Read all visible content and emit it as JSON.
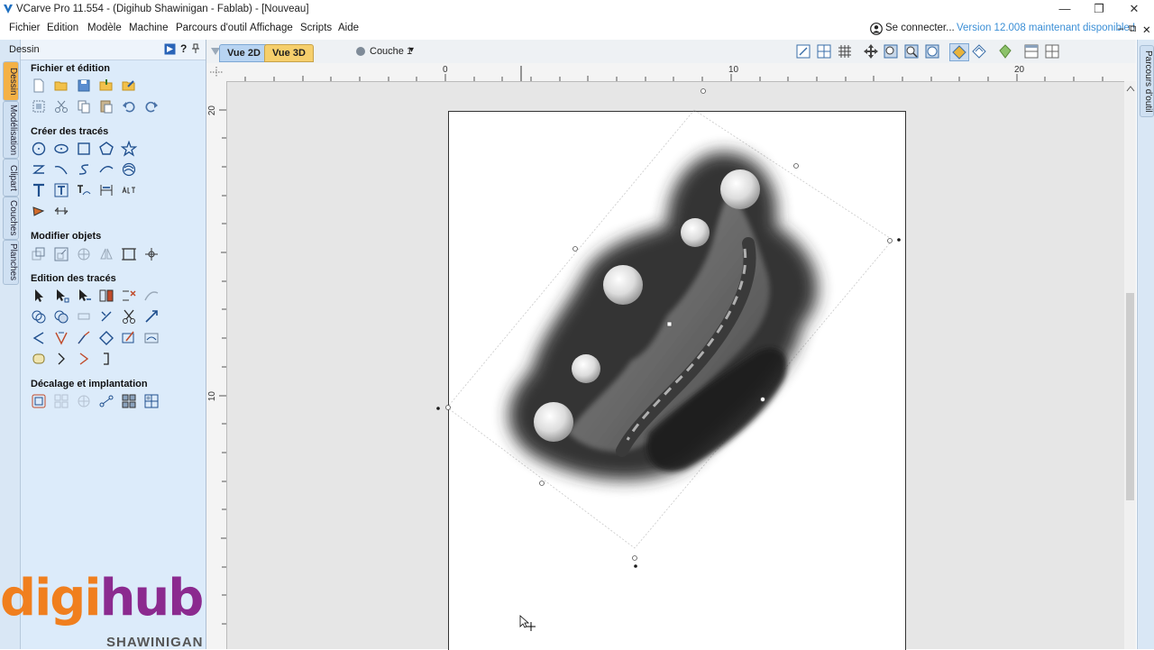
{
  "window": {
    "title": "VCarve Pro 11.554 - (Digihub Shawinigan - Fablab) - [Nouveau]",
    "controls": [
      "—",
      "❐",
      "✕"
    ]
  },
  "menubar": {
    "items": [
      "Fichier",
      "Edition",
      "Modèle",
      "Machine",
      "Parcours d'outil",
      "Affichage",
      "Scripts",
      "Aide"
    ],
    "login": "Se connecter...",
    "version_notice": "Version 12.008 maintenant disponible !",
    "mdi_controls": [
      "–",
      "⧉",
      "✕"
    ]
  },
  "side_tabs": [
    "Dessin",
    "Modélisation",
    "Clipart",
    "Couches",
    "Planches"
  ],
  "right_tab": "Parcours d'outil",
  "panel": {
    "title": "Dessin",
    "sections": [
      {
        "title": "Fichier et édition"
      },
      {
        "title": "Créer des tracés"
      },
      {
        "title": "Modifier objets"
      },
      {
        "title": "Edition des tracés"
      },
      {
        "title": "Décalage et implantation"
      }
    ]
  },
  "viewbar": {
    "tab_2d": "Vue 2D",
    "tab_3d": "Vue 3D",
    "layer": "Couche 1"
  },
  "rulers": {
    "h_labels": [
      "0",
      "10",
      "20"
    ],
    "v_labels": [
      "20",
      "10"
    ]
  },
  "watermark": {
    "main": "digihub",
    "sub": "SHAWINIGAN"
  },
  "colors": {
    "panel_bg": "#dcebfa",
    "tab_active": "#f4b146",
    "version_link": "#3b8fd6",
    "watermark_orange": "#f07f1e",
    "watermark_purple": "#8b2a8f"
  }
}
